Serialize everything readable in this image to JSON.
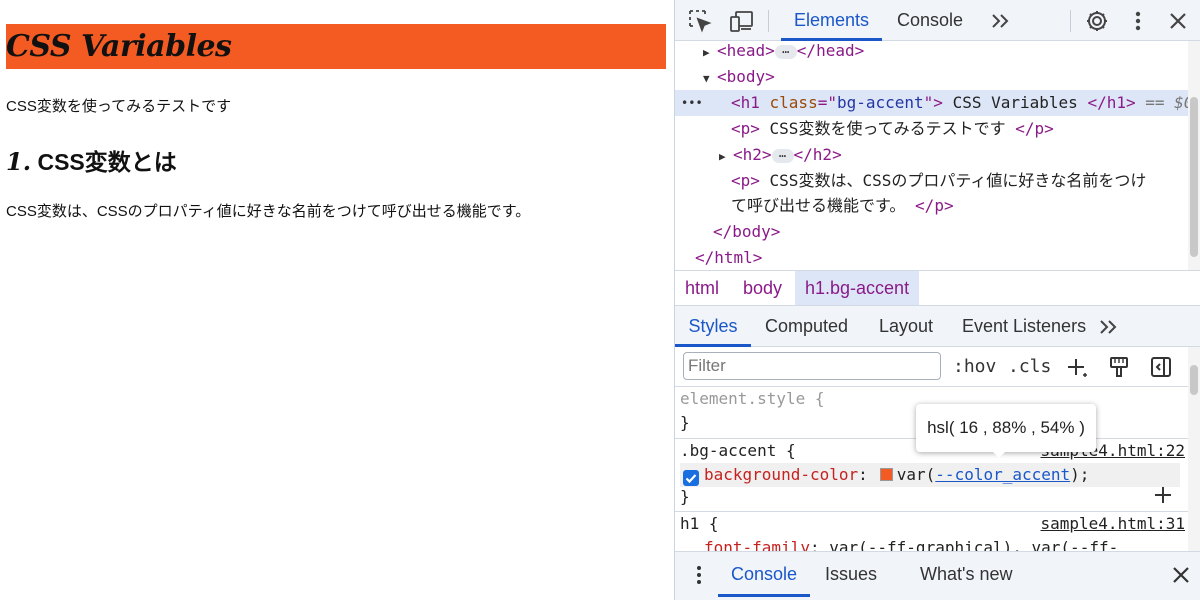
{
  "page": {
    "h1": "CSS Variables",
    "p1": "CSS変数を使ってみるテストです",
    "h2_number": "1.",
    "h2_text": " CSS変数とは",
    "p2": "CSS変数は、CSSのプロパティ値に好きな名前をつけて呼び出せる機能です。",
    "accent_color": "#f35b23"
  },
  "devtools": {
    "toolbar": {
      "tabs": [
        "Elements",
        "Console"
      ],
      "active_tab": "Elements",
      "icons": [
        "inspect-icon",
        "device-toolbar-icon",
        "more-tabs-icon",
        "settings-icon",
        "kebab-menu-icon",
        "close-icon"
      ]
    },
    "dom_tree": {
      "head_open": "<head>",
      "head_close": "</head>",
      "body_open": "<body>",
      "h1_open_tag": "<h1 ",
      "h1_attr_name": "class",
      "h1_attr_eq": "=\"",
      "h1_attr_value": "bg-accent",
      "h1_attr_end": "\">",
      "h1_text": " CSS Variables ",
      "h1_close": "</h1>",
      "h1_marker": " == $0",
      "p1_open": "<p>",
      "p1_text": " CSS変数を使ってみるテストです ",
      "p1_close": "</p>",
      "h2_open": "<h2>",
      "h2_close": "</h2>",
      "p2_open": "<p>",
      "p2_text_line1": " CSS変数は、CSSのプロパティ値に好きな名前をつけ",
      "p2_text_line2": "て呼び出せる機能です。 ",
      "p2_close": "</p>",
      "body_close": "</body>",
      "html_close": "</html>",
      "ellipsis": "…",
      "row_dots": "•••"
    },
    "breadcrumb": [
      "html",
      "body",
      "h1.bg-accent"
    ],
    "styles_tabs": [
      "Styles",
      "Computed",
      "Layout",
      "Event Listeners"
    ],
    "active_styles_tab": "Styles",
    "filter": {
      "placeholder": "Filter",
      "value": ""
    },
    "filter_buttons": {
      "hov": ":hov",
      "cls": ".cls"
    },
    "rules": {
      "element_style_selector": "element.style {",
      "element_style_close": "}",
      "bg_accent_selector": ".bg-accent {",
      "bg_accent_source": "sample4.html:22",
      "bg_prop_name": "background-color",
      "bg_prop_colon": ":",
      "bg_var_open": "var(",
      "bg_var_name": "--color_accent",
      "bg_var_close": ");",
      "bg_accent_close": "}",
      "bg_checked": true,
      "h1_selector": "h1 {",
      "h1_source": "sample4.html:31",
      "h1_prop_name": "font-family",
      "h1_prop_value": ": var(--ff-graphical), var(--ff-"
    },
    "tooltip": "hsl( 16 , 88% , 54% )",
    "drawer": {
      "tabs": [
        "Console",
        "Issues",
        "What's new"
      ],
      "active_tab": "Console"
    }
  }
}
